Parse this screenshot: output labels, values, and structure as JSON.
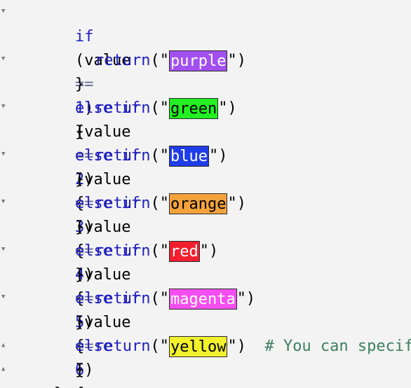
{
  "code": {
    "line1": {
      "kw": "if",
      "open": "(",
      "ident": "value",
      "op": "==",
      "num": "1",
      "close": ")",
      "brace": "{"
    },
    "ret1": {
      "fn": "return",
      "open": "(\"",
      "close": "\")",
      "value": "purple",
      "color": "#a24ff0"
    },
    "line2": {
      "brace_close": "}",
      "kw": "else if",
      "open": "(",
      "ident": "value",
      "op": "==",
      "num": "2",
      "close": ")",
      "brace": "{"
    },
    "ret2": {
      "fn": "return",
      "open": "(\"",
      "close": "\")",
      "value": "green",
      "color": "#22f022"
    },
    "line3": {
      "brace_close": "}",
      "kw": "else if",
      "open": "(",
      "ident": "value",
      "op": "==",
      "num": "3",
      "close": ")",
      "brace": "{"
    },
    "ret3": {
      "fn": "return",
      "open": "(\"",
      "close": "\")",
      "value": "blue",
      "color": "#1f3de8"
    },
    "line4": {
      "brace_close": "}",
      "kw": "else if",
      "open": "(",
      "ident": "value",
      "op": "==",
      "num": "4",
      "close": ")",
      "brace": "{"
    },
    "ret4": {
      "fn": "return",
      "open": "(\"",
      "close": "\")",
      "value": "orange",
      "color": "#f4a23c"
    },
    "line5": {
      "brace_close": "}",
      "kw": "else if",
      "open": "(",
      "ident": "value",
      "op": "==",
      "num": "5",
      "close": ")",
      "brace": "{"
    },
    "ret5": {
      "fn": "return",
      "open": "(\"",
      "close": "\")",
      "value": "red",
      "color": "#f21f2f"
    },
    "line6": {
      "brace_close": "}",
      "kw": "else if",
      "open": "(",
      "ident": "value",
      "op": "==",
      "num": "6",
      "close": ")",
      "brace": "{"
    },
    "ret6": {
      "fn": "return",
      "open": "(\"",
      "close": "\")",
      "value": "magenta",
      "color": "#f54ef0"
    },
    "line7": {
      "brace_close": "}",
      "kw": "else",
      "brace": "{"
    },
    "ret7": {
      "fn": "return",
      "open": "(\"",
      "close": "\")",
      "value": "yellow",
      "color": "#f3f12e",
      "comment": "# You can specify"
    },
    "close_inner": "}",
    "close_outer": "}"
  },
  "gutter": {
    "fold_down_icon": "triangle-down",
    "fold_up_icon": "triangle-up"
  }
}
